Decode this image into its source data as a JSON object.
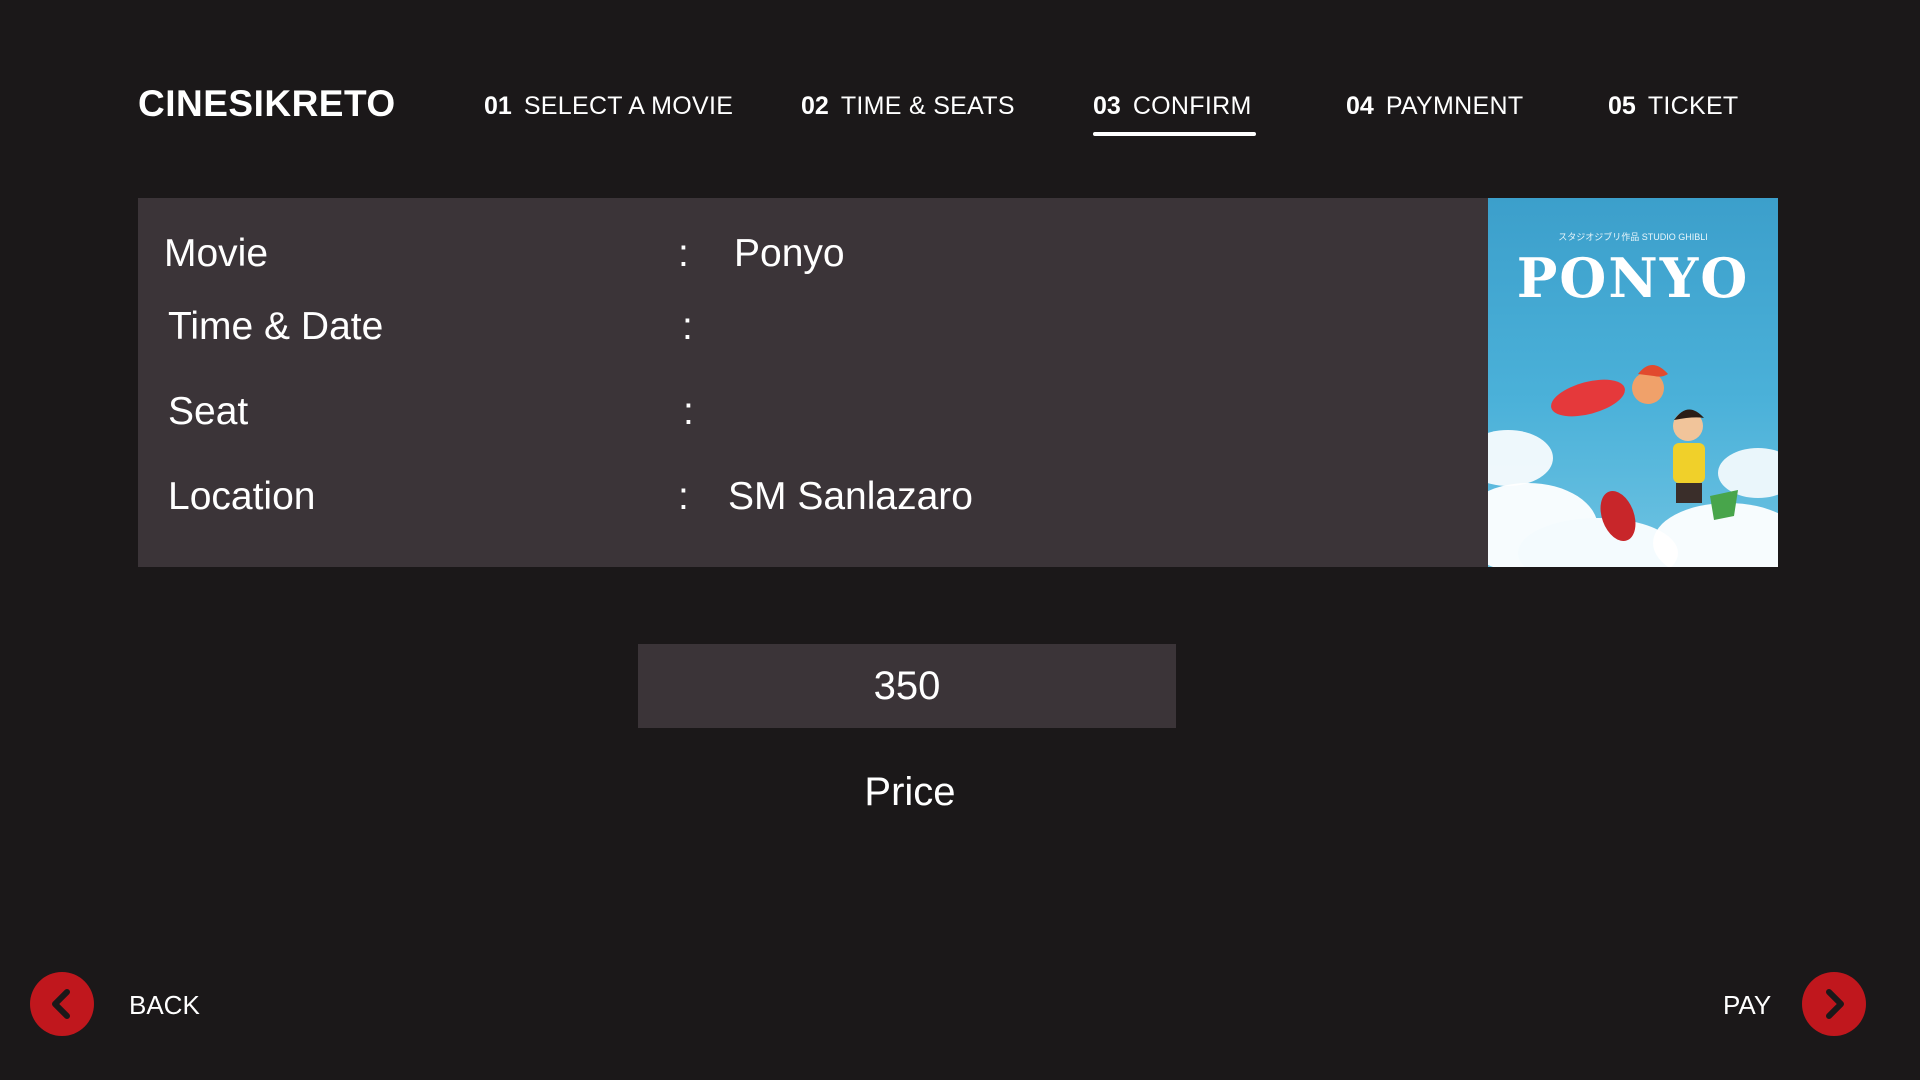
{
  "app": {
    "brand": "CINESIKRETO"
  },
  "steps": [
    {
      "num": "01",
      "label": "SELECT A MOVIE",
      "active": false
    },
    {
      "num": "02",
      "label": "TIME & SEATS",
      "active": false
    },
    {
      "num": "03",
      "label": "CONFIRM",
      "active": true
    },
    {
      "num": "04",
      "label": "PAYMNENT",
      "active": false
    },
    {
      "num": "05",
      "label": "TICKET",
      "active": false
    }
  ],
  "details": {
    "movie_label": "Movie",
    "movie_value": "Ponyo",
    "time_label": "Time & Date",
    "time_value": "",
    "seat_label": "Seat",
    "seat_value": "",
    "location_label": "Location",
    "location_value": "SM Sanlazaro",
    "separator": ":"
  },
  "poster": {
    "title": "PONYO",
    "subtitle": "スタジオジブリ作品 STUDIO GHIBLI"
  },
  "price": {
    "value": "350",
    "label": "Price"
  },
  "footer": {
    "back_label": "BACK",
    "pay_label": "PAY"
  },
  "colors": {
    "background": "#1b1819",
    "panel": "#3b3438",
    "accent": "#c0171d",
    "poster_sky": "#4bb1d9"
  },
  "icons": {
    "back": "chevron-left-icon",
    "pay": "chevron-right-icon"
  }
}
